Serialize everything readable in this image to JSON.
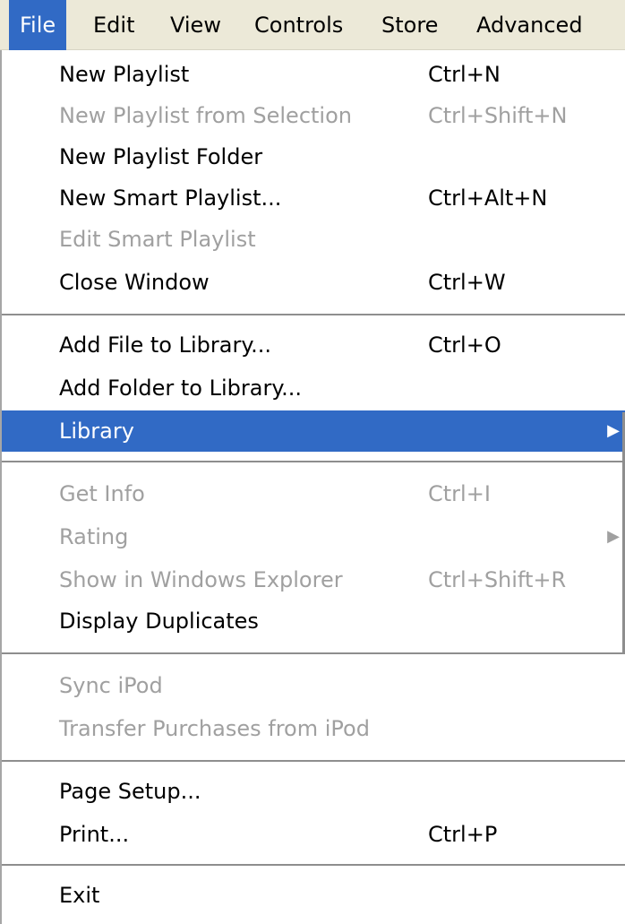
{
  "menubar": {
    "items": [
      "File",
      "Edit",
      "View",
      "Controls",
      "Store",
      "Advanced"
    ]
  },
  "menu": {
    "items": [
      {
        "label": "New Playlist",
        "shortcut": "Ctrl+N",
        "enabled": true
      },
      {
        "label": "New Playlist from Selection",
        "shortcut": "Ctrl+Shift+N",
        "enabled": false
      },
      {
        "label": "New Playlist Folder",
        "shortcut": "",
        "enabled": true
      },
      {
        "label": "New Smart Playlist...",
        "shortcut": "Ctrl+Alt+N",
        "enabled": true
      },
      {
        "label": "Edit Smart Playlist",
        "shortcut": "",
        "enabled": false
      },
      {
        "label": "Close Window",
        "shortcut": "Ctrl+W",
        "enabled": true
      },
      {
        "label": "Add File to Library...",
        "shortcut": "Ctrl+O",
        "enabled": true
      },
      {
        "label": "Add Folder to Library...",
        "shortcut": "",
        "enabled": true
      },
      {
        "label": "Library",
        "shortcut": "",
        "enabled": true,
        "submenu": true,
        "selected": true
      },
      {
        "label": "Get Info",
        "shortcut": "Ctrl+I",
        "enabled": false
      },
      {
        "label": "Rating",
        "shortcut": "",
        "enabled": false,
        "submenu": true
      },
      {
        "label": "Show in Windows Explorer",
        "shortcut": "Ctrl+Shift+R",
        "enabled": false
      },
      {
        "label": "Display Duplicates",
        "shortcut": "",
        "enabled": true
      },
      {
        "label": "Sync iPod",
        "shortcut": "",
        "enabled": false
      },
      {
        "label": "Transfer Purchases from iPod",
        "shortcut": "",
        "enabled": false
      },
      {
        "label": "Page Setup...",
        "shortcut": "",
        "enabled": true
      },
      {
        "label": "Print...",
        "shortcut": "Ctrl+P",
        "enabled": true
      },
      {
        "label": "Exit",
        "shortcut": "",
        "enabled": true
      }
    ]
  },
  "colors": {
    "selection": "#316ac5",
    "disabled_text": "#a0a0a0",
    "menubar_bg": "#ece9d8"
  }
}
